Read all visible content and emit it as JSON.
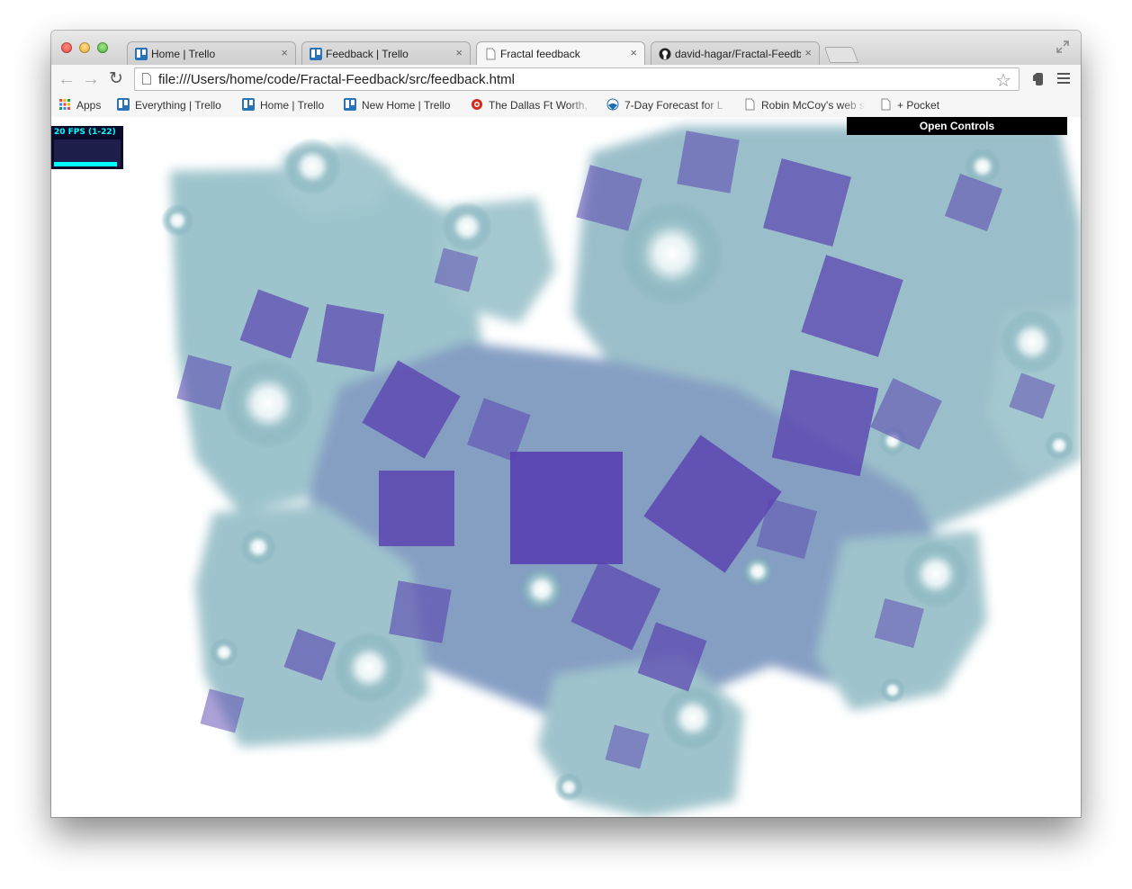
{
  "browser": {
    "tabs": [
      {
        "title": "Home | Trello",
        "favicon": "trello-icon"
      },
      {
        "title": "Feedback | Trello",
        "favicon": "trello-icon"
      },
      {
        "title": "Fractal feedback",
        "favicon": "page-icon",
        "active": true
      },
      {
        "title": "david-hagar/Fractal-Feedb",
        "favicon": "github-icon"
      }
    ],
    "close_glyph": "×",
    "url": "file:///Users/home/code/Fractal-Feedback/src/feedback.html"
  },
  "bookmarks": [
    {
      "label": "Apps",
      "icon": "apps-grid-icon"
    },
    {
      "label": "Everything | Trello",
      "icon": "trello-icon"
    },
    {
      "label": "Home | Trello",
      "icon": "trello-icon"
    },
    {
      "label": "New Home | Trello",
      "icon": "trello-icon"
    },
    {
      "label": "The Dallas Ft Worth,",
      "icon": "gear-icon"
    },
    {
      "label": "7-Day Forecast for L",
      "icon": "noaa-icon"
    },
    {
      "label": "Robin McCoy's web s",
      "icon": "page-icon"
    },
    {
      "label": "+ Pocket",
      "icon": "page-icon"
    }
  ],
  "page": {
    "fps_label": "20 FPS (1-22)",
    "fps_level": 0.95,
    "controls_label": "Open Controls"
  },
  "colors": {
    "fractal_purple": "#5a44b0",
    "fractal_teal": "#6fa3b0",
    "fps_cyan": "#00ffff",
    "fps_bg": "#0a0a2a"
  }
}
